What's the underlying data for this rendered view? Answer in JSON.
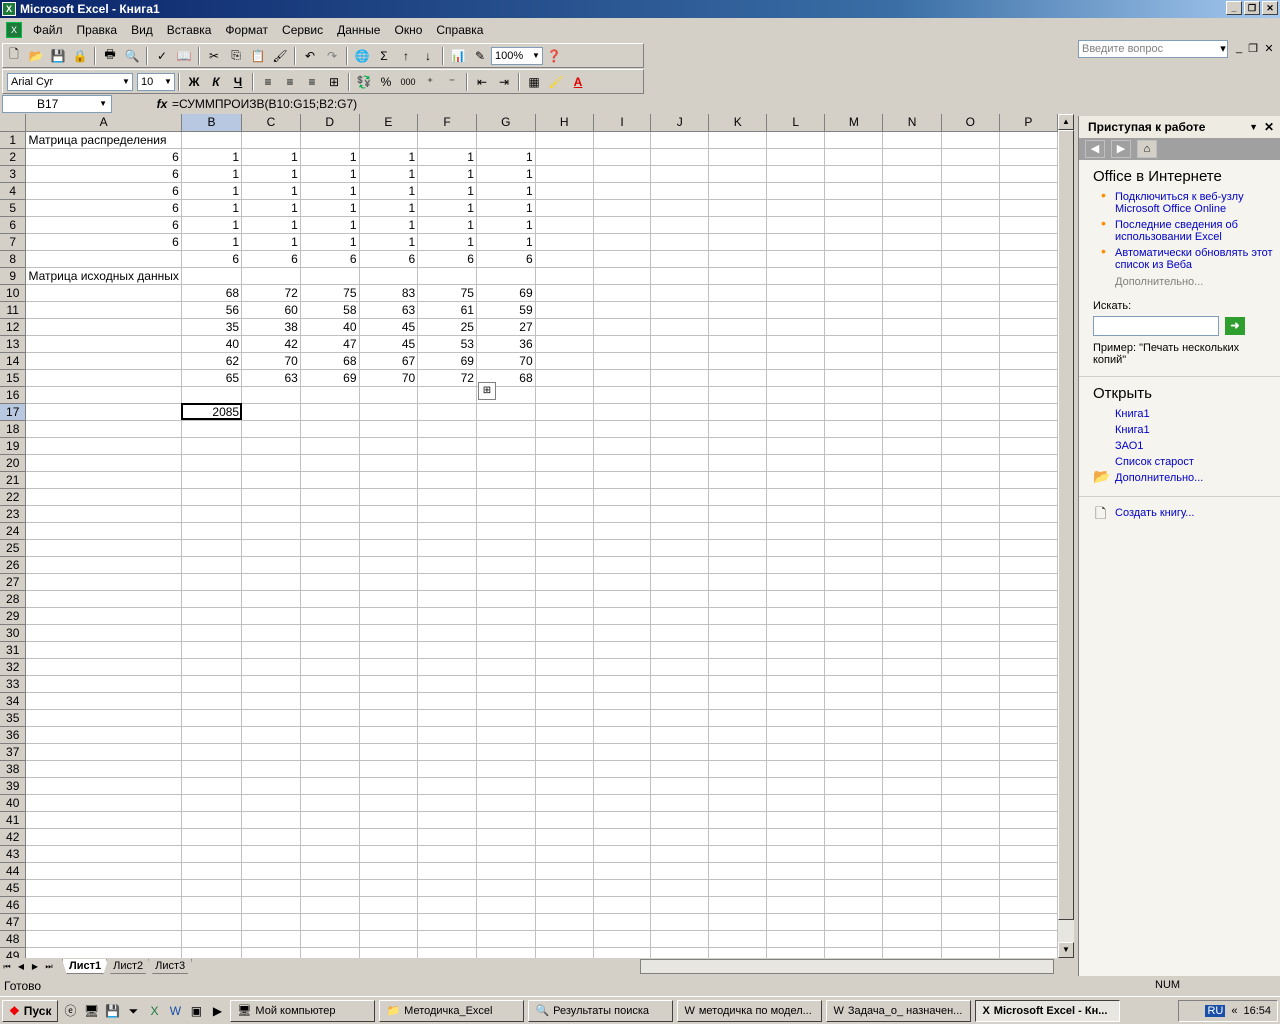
{
  "window": {
    "title": "Microsoft Excel - Книга1"
  },
  "menu": {
    "items": [
      "Файл",
      "Правка",
      "Вид",
      "Вставка",
      "Формат",
      "Сервис",
      "Данные",
      "Окно",
      "Справка"
    ],
    "ask_placeholder": "Введите вопрос"
  },
  "toolbar": {
    "zoom": "100%",
    "font_name": "Arial Cyr",
    "font_size": "10",
    "bold": "Ж",
    "italic": "К",
    "underline": "Ч",
    "sigma": "Σ",
    "percent": "%",
    "thousands": "000"
  },
  "formula_bar": {
    "cell_ref": "B17",
    "fx": "fx",
    "formula": "=СУММПРОИЗВ(B10:G15;B2:G7)"
  },
  "grid": {
    "columns": [
      "A",
      "B",
      "C",
      "D",
      "E",
      "F",
      "G",
      "H",
      "I",
      "J",
      "K",
      "L",
      "M",
      "N",
      "O",
      "P"
    ],
    "rows": [
      [
        "Матрица распределения",
        "",
        "",
        "",
        "",
        "",
        ""
      ],
      [
        "6",
        "1",
        "1",
        "1",
        "1",
        "1",
        "1"
      ],
      [
        "6",
        "1",
        "1",
        "1",
        "1",
        "1",
        "1"
      ],
      [
        "6",
        "1",
        "1",
        "1",
        "1",
        "1",
        "1"
      ],
      [
        "6",
        "1",
        "1",
        "1",
        "1",
        "1",
        "1"
      ],
      [
        "6",
        "1",
        "1",
        "1",
        "1",
        "1",
        "1"
      ],
      [
        "6",
        "1",
        "1",
        "1",
        "1",
        "1",
        "1"
      ],
      [
        "",
        "6",
        "6",
        "6",
        "6",
        "6",
        "6"
      ],
      [
        "Матрица исходных данных",
        "",
        "",
        "",
        "",
        "",
        ""
      ],
      [
        "",
        "68",
        "72",
        "75",
        "83",
        "75",
        "69"
      ],
      [
        "",
        "56",
        "60",
        "58",
        "63",
        "61",
        "59"
      ],
      [
        "",
        "35",
        "38",
        "40",
        "45",
        "25",
        "27"
      ],
      [
        "",
        "40",
        "42",
        "47",
        "45",
        "53",
        "36"
      ],
      [
        "",
        "62",
        "70",
        "68",
        "67",
        "69",
        "70"
      ],
      [
        "",
        "65",
        "63",
        "69",
        "70",
        "72",
        "68"
      ],
      [
        "",
        "",
        "",
        "",
        "",
        "",
        ""
      ],
      [
        "",
        "2085",
        "",
        "",
        "",
        "",
        ""
      ]
    ],
    "row_count": 49
  },
  "sheets": {
    "tabs": [
      "Лист1",
      "Лист2",
      "Лист3"
    ],
    "active": "Лист1"
  },
  "status": {
    "left": "Готово",
    "num": "NUM"
  },
  "task_pane": {
    "title": "Приступая к работе",
    "section1": "Office в Интернете",
    "links1": [
      "Подключиться к веб-узлу Microsoft Office Online",
      "Последние сведения об использовании Excel",
      "Автоматически обновлять этот список из Веба"
    ],
    "more1": "Дополнительно...",
    "search_label": "Искать:",
    "example": "Пример: \"Печать нескольких копий\"",
    "section2": "Открыть",
    "files": [
      "Книга1",
      "Книга1",
      "ЗАО1",
      "Список старост"
    ],
    "more2": "Дополнительно...",
    "create": "Создать книгу..."
  },
  "taskbar": {
    "start": "Пуск",
    "tasks": [
      "Мой компьютер",
      "Методичка_Excel",
      "Результаты поиска",
      "методичка по модел...",
      "Задача_о_ назначен...",
      "Microsoft Excel - Кн..."
    ],
    "lang": "RU",
    "clock": "16:54"
  }
}
